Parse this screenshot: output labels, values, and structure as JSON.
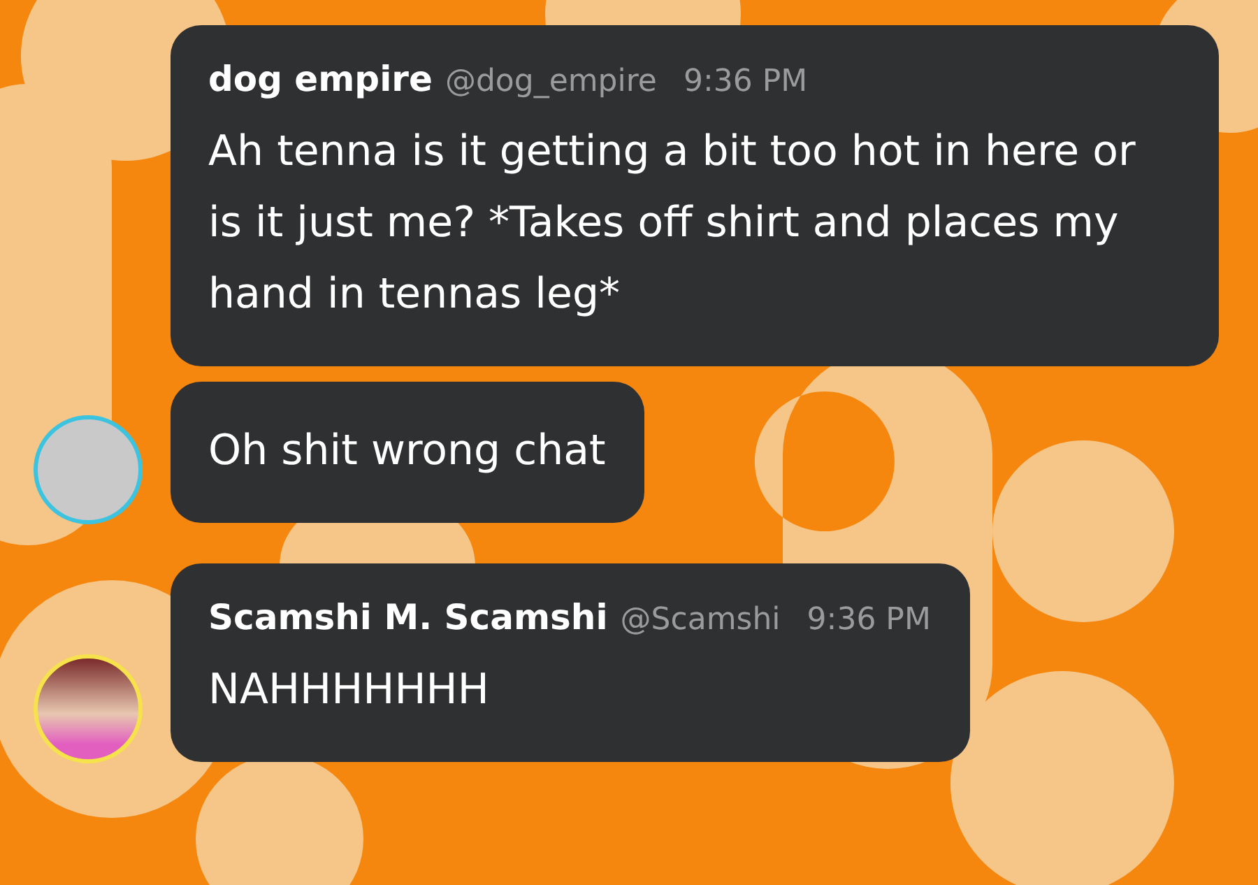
{
  "groups": [
    {
      "author": "dog empire",
      "handle": "@dog_empire",
      "time": "9:36 PM",
      "messages": [
        "Ah tenna is it getting a bit too hot in here or is it just me? *Takes off shirt and places my hand in tennas leg*",
        "Oh shit wrong chat"
      ]
    },
    {
      "author": "Scamshi M. Scamshi",
      "handle": "@Scamshi",
      "time": "9:36 PM",
      "messages": [
        "NAHHHHHHH"
      ]
    }
  ]
}
